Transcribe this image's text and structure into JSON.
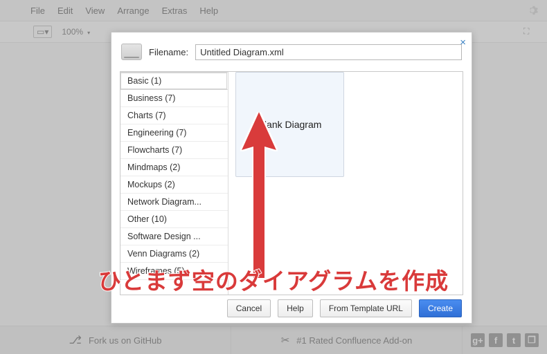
{
  "menubar": {
    "items": [
      "File",
      "Edit",
      "View",
      "Arrange",
      "Extras",
      "Help"
    ]
  },
  "toolbar": {
    "zoom": "100%"
  },
  "dialog": {
    "filename_label": "Filename:",
    "filename_value": "Untitled Diagram.xml",
    "categories": [
      {
        "label": "Basic (1)",
        "selected": true
      },
      {
        "label": "Business (7)"
      },
      {
        "label": "Charts (7)"
      },
      {
        "label": "Engineering (7)"
      },
      {
        "label": "Flowcharts (7)"
      },
      {
        "label": "Mindmaps (2)"
      },
      {
        "label": "Mockups (2)"
      },
      {
        "label": "Network Diagram..."
      },
      {
        "label": "Other (10)"
      },
      {
        "label": "Software Design ..."
      },
      {
        "label": "Venn Diagrams (2)"
      },
      {
        "label": "Wireframes (5)"
      }
    ],
    "template_card": "Blank Diagram",
    "buttons": {
      "cancel": "Cancel",
      "help": "Help",
      "from_url": "From Template URL",
      "create": "Create"
    },
    "close_glyph": "×"
  },
  "footer": {
    "github_label": "Fork us on GitHub",
    "addon_label": "#1 Rated Confluence Add-on",
    "social": [
      "g+",
      "f",
      "t",
      "❐"
    ]
  },
  "annotation": {
    "text": "ひとまず空のダイアグラムを作成"
  }
}
